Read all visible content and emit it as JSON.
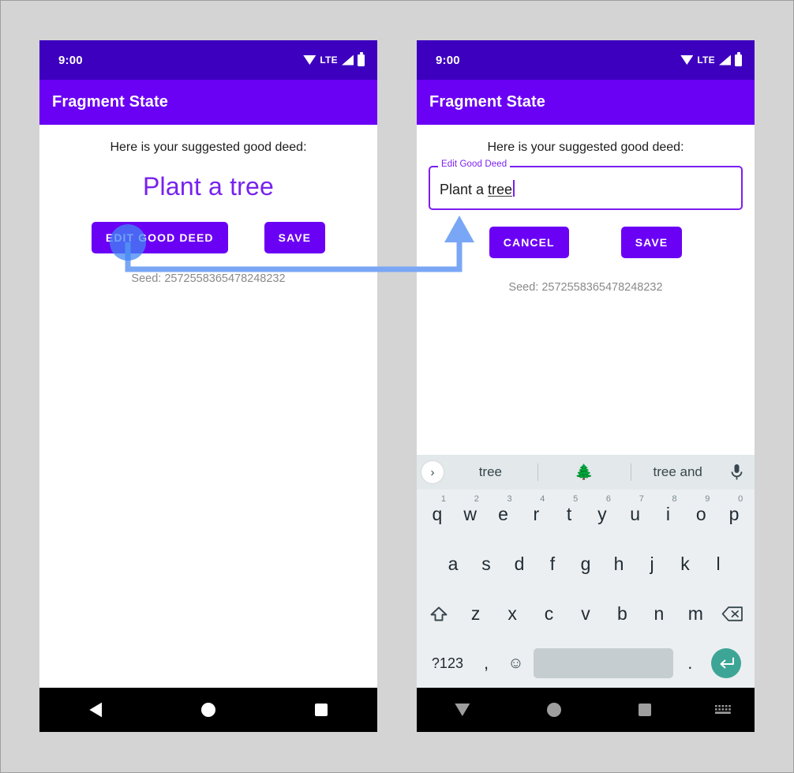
{
  "screens": {
    "left": {
      "status_bar": {
        "time": "9:00",
        "network": "LTE"
      },
      "app_bar": {
        "title": "Fragment State"
      },
      "prompt": "Here is your suggested good deed:",
      "deed_text": "Plant a tree",
      "buttons": [
        {
          "label": "EDIT GOOD DEED",
          "name": "edit-good-deed-button"
        },
        {
          "label": "SAVE",
          "name": "save-button"
        }
      ],
      "seed": "Seed: 2572558365478248232",
      "nav": {
        "back": "back-icon",
        "home": "home-icon",
        "recents": "recents-icon"
      }
    },
    "right": {
      "status_bar": {
        "time": "9:00",
        "network": "LTE"
      },
      "app_bar": {
        "title": "Fragment State"
      },
      "prompt": "Here is your suggested good deed:",
      "textfield": {
        "label": "Edit Good Deed",
        "value_prefix": "Plant a ",
        "value_misspelled": "tree",
        "full_value": "Plant a tree"
      },
      "buttons": [
        {
          "label": "CANCEL",
          "name": "cancel-button"
        },
        {
          "label": "SAVE",
          "name": "save-button"
        }
      ],
      "seed": "Seed: 2572558365478248232",
      "nav": {
        "dismiss": "dismiss-keyboard-icon",
        "home": "home-icon",
        "recents": "recents-icon",
        "keyboard": "keyboard-switch-icon"
      }
    }
  },
  "keyboard": {
    "expand_icon": "›",
    "suggestions": [
      {
        "text": "tree",
        "kind": "word"
      },
      {
        "text": "🌲",
        "kind": "emoji"
      },
      {
        "text": "tree and",
        "kind": "word"
      }
    ],
    "mic_icon": "mic-icon",
    "row1": [
      {
        "key": "q",
        "num": "1"
      },
      {
        "key": "w",
        "num": "2"
      },
      {
        "key": "e",
        "num": "3"
      },
      {
        "key": "r",
        "num": "4"
      },
      {
        "key": "t",
        "num": "5"
      },
      {
        "key": "y",
        "num": "6"
      },
      {
        "key": "u",
        "num": "7"
      },
      {
        "key": "i",
        "num": "8"
      },
      {
        "key": "o",
        "num": "9"
      },
      {
        "key": "p",
        "num": "0"
      }
    ],
    "row2": [
      "a",
      "s",
      "d",
      "f",
      "g",
      "h",
      "j",
      "k",
      "l"
    ],
    "row3": [
      "z",
      "x",
      "c",
      "v",
      "b",
      "n",
      "m"
    ],
    "row4": {
      "symbols": "?123",
      "comma": ",",
      "emoji": "☺",
      "space": "",
      "period": "."
    }
  },
  "colors": {
    "status_bar": "#3d00bf",
    "app_bar": "#6a00f4",
    "primary": "#6a00f4",
    "deed_text": "#7722ee",
    "textfield_outline": "#7b1ff0",
    "annotation_arrow": "#7aa7f5",
    "tap_indicator": "#4285f4",
    "enter_key": "#3da596",
    "keyboard_bg": "#eceff1",
    "page_bg": "#d4d4d4"
  },
  "annotation": {
    "description": "flow arrow from edit-good-deed-button to edit-text-field"
  }
}
